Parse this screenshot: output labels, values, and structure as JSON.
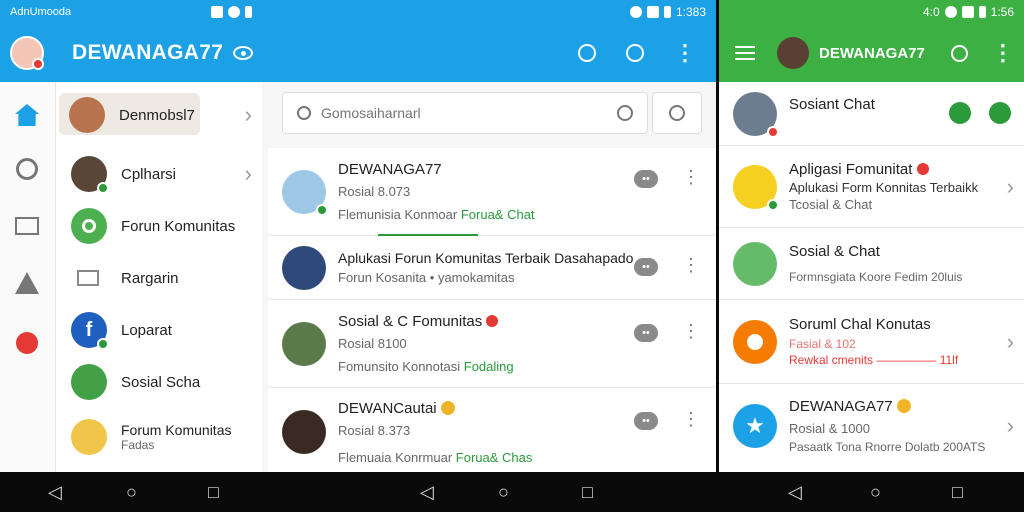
{
  "colors": {
    "blue": "#1da1e6",
    "green": "#3cb043",
    "accent_red": "#e53935",
    "accent_green": "#2b9a3a"
  },
  "left_status": {
    "left": "AdnUmooda",
    "time": ""
  },
  "middle_status": {
    "time": "1:383"
  },
  "right_status": {
    "time": "1:56",
    "left": "4:0"
  },
  "blue_header": {
    "title": "DEWANAGA77",
    "icons": [
      "avatar",
      "eye-icon",
      "search-icon",
      "search-icon",
      "more-vert-icon"
    ]
  },
  "green_header": {
    "title": "DEWANAGA77",
    "icons": [
      "menu-icon",
      "avatar",
      "search-icon",
      "more-vert-icon"
    ]
  },
  "rail": {
    "icons": [
      "home-icon",
      "chat-icon",
      "mail-icon",
      "alert-icon",
      "red-badge-icon"
    ]
  },
  "drawer": {
    "items": [
      {
        "name": "Denmobsl7",
        "sub": "",
        "selected": true
      },
      {
        "name": "Cplharsi",
        "sub": ""
      },
      {
        "name": "Forun Komunitas",
        "sub": ""
      },
      {
        "name": "Rargarin",
        "sub": ""
      },
      {
        "name": "Loparat",
        "sub": ""
      },
      {
        "name": "Sosial Scha",
        "sub": ""
      },
      {
        "name": "Forum Komunitas",
        "sub": "Fadas"
      }
    ]
  },
  "search": {
    "placeholder": "Gomosaiharnarl"
  },
  "middle_list": [
    {
      "title": "DEWANAGA77",
      "line2": "Rosial 8.073",
      "line3a": "Flemunisia Konmoar",
      "line3b": "Forua& Chat"
    },
    {
      "title": "Aplukasi Forun Komunitas Terbaik Dasahapado",
      "line2": "Forun Kosanita • yamokamitas",
      "line3a": "",
      "line3b": ""
    },
    {
      "title": "Sosial & C Fomunitas",
      "line2": "Rosial 8100",
      "line3a": "Fomunsito Konnotasi",
      "line3b": "Fodaling"
    },
    {
      "title": "DEWANCautai",
      "line2": "Rosial 8.373",
      "line3a": "Flemuaia Konrmuar",
      "line3b": "Forua& Chas"
    }
  ],
  "right_list": [
    {
      "title": "Sosiant Chat",
      "line2": "",
      "line3": ""
    },
    {
      "title": "Apligasi Fomunitat",
      "line2": "Aplukasi Form Konnitas Terbaikk",
      "line3": "Tcosial & Chat"
    },
    {
      "title": "Sosial & Chat",
      "line2": "Formnsgiata Koore Fedim 20luis",
      "line3": ""
    },
    {
      "title": "Soruml Chal Konutas",
      "line2": "Fasial & 102",
      "line3": "Rewkal cmenits ————— 11lf"
    },
    {
      "title": "DEWANAGA77",
      "line2": "Rosial & 1000",
      "line3": "Pasaatk Tona Rnorre Dolatb 200ATS"
    }
  ]
}
